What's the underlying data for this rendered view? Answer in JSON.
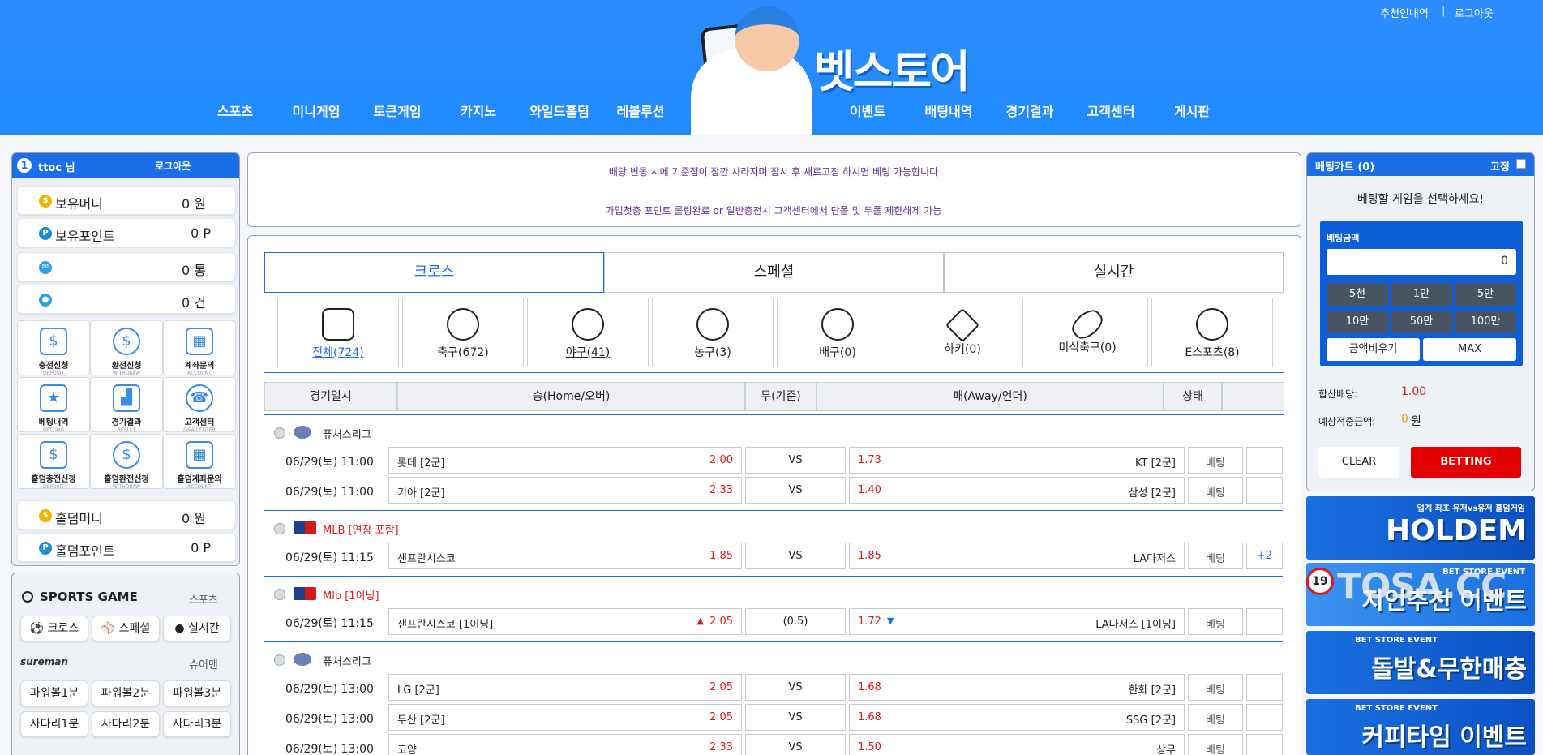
{
  "header": {
    "top_links": [
      "추천인내역",
      "로그아웃"
    ],
    "logo": "벳스토어",
    "nav_left": [
      "스포츠",
      "미니게임",
      "토큰게임",
      "카지노",
      "와일드홀덤",
      "레볼루션"
    ],
    "nav_right": [
      "이벤트",
      "배팅내역",
      "경기결과",
      "고객센터",
      "게시판"
    ],
    "colors": {
      "header_bg": "#1f8bff",
      "accent": "#0d6efd"
    }
  },
  "user": {
    "level": "1",
    "name": "ttoc 님",
    "logout": "로그아웃",
    "rows": [
      {
        "label": "보유머니",
        "value": "0 원",
        "icon": "coin-icon"
      },
      {
        "label": "보유포인트",
        "value": "0 P",
        "icon": "point-icon"
      },
      {
        "label": "",
        "value": "0 통",
        "icon": "bird-icon"
      },
      {
        "label": "",
        "value": "0 건",
        "icon": "message-icon"
      }
    ],
    "grid": [
      {
        "label": "충전신청",
        "en": "DEPOSIT",
        "icon": "deposit-icon"
      },
      {
        "label": "환전신청",
        "en": "WITHDRAW",
        "icon": "withdraw-icon"
      },
      {
        "label": "계좌문의",
        "en": "ACCOUNT",
        "icon": "account-icon"
      },
      {
        "label": "베팅내역",
        "en": "BETTING",
        "icon": "trophy-icon"
      },
      {
        "label": "경기결과",
        "en": "RESULT",
        "icon": "podium-icon"
      },
      {
        "label": "고객센터",
        "en": "Q&A CENTER",
        "icon": "phone-icon"
      },
      {
        "label": "홀덤충전신청",
        "en": "DEPOSIT",
        "icon": "deposit-icon"
      },
      {
        "label": "홀덤환전신청",
        "en": "WITHDRAW",
        "icon": "withdraw-icon"
      },
      {
        "label": "홀덤계좌문의",
        "en": "ACCOUNT",
        "icon": "account-icon"
      }
    ],
    "holdem_rows": [
      {
        "label": "홀덤머니",
        "value": "0 원"
      },
      {
        "label": "홀덤포인트",
        "value": "0 P"
      }
    ]
  },
  "sports_game": {
    "title": "SPORTS GAME",
    "sub": "스포츠",
    "buttons": [
      "크로스",
      "스페셜",
      "실시간"
    ],
    "sureman_logo": "sureman",
    "sureman_sub": "슈어맨",
    "mini": [
      "파워볼1분",
      "파워볼2분",
      "파워볼3분",
      "사다리1분",
      "사다리2분",
      "사다리3분"
    ]
  },
  "notices": [
    "배당 변동 시에 기준점이 잠깐 사라지며 잠시 후 새로고침 하시면 베팅 가능합니다",
    "가입첫충 포인트 롤링완료 or 일반충전시 고객센터에서 단폴 및 두폴 제한해제 가능"
  ],
  "tabs": [
    "크로스",
    "스페셜",
    "실시간"
  ],
  "sports": [
    {
      "label": "전체(724)",
      "icon": "grid-icon"
    },
    {
      "label": "축구(672)",
      "icon": "soccer-icon"
    },
    {
      "label": "야구(41)",
      "icon": "baseball-icon"
    },
    {
      "label": "농구(3)",
      "icon": "basketball-icon"
    },
    {
      "label": "배구(0)",
      "icon": "volleyball-icon"
    },
    {
      "label": "하키(0)",
      "icon": "hockey-icon"
    },
    {
      "label": "미식축구(0)",
      "icon": "football-icon"
    },
    {
      "label": "E스포츠(8)",
      "icon": "esports-icon"
    }
  ],
  "table_headers": [
    "경기일시",
    "승(Home/오버)",
    "무(기준)",
    "패(Away/언더)",
    "상태"
  ],
  "leagues": [
    {
      "name": "퓨처스리그",
      "red": false,
      "flag": "kbo",
      "games": [
        {
          "time": "06/29(토) 11:00",
          "home": "롯데 [2군]",
          "ho": "2.00",
          "mid": "VS",
          "ao": "1.73",
          "away": "KT [2군]",
          "status": "베팅",
          "more": ""
        },
        {
          "time": "06/29(토) 11:00",
          "home": "기아 [2군]",
          "ho": "2.33",
          "mid": "VS",
          "ao": "1.40",
          "away": "삼성 [2군]",
          "status": "베팅",
          "more": ""
        }
      ]
    },
    {
      "name": "MLB [연장 포함]",
      "red": true,
      "flag": "mlb",
      "games": [
        {
          "time": "06/29(토) 11:15",
          "home": "샌프란시스코",
          "ho": "1.85",
          "mid": "VS",
          "ao": "1.85",
          "away": "LA다저스",
          "status": "베팅",
          "more": "+2"
        }
      ]
    },
    {
      "name": "Mlb [1이닝]",
      "red": true,
      "flag": "mlb",
      "games": [
        {
          "time": "06/29(토) 11:15",
          "home": "샌프란시스코 [1이닝]",
          "ho": "2.05",
          "mid": "(0.5)",
          "ao": "1.72",
          "away": "LA다저스 [1이닝]",
          "status": "베팅",
          "more": "",
          "up": true
        }
      ]
    },
    {
      "name": "퓨처스리그",
      "red": false,
      "flag": "kbo",
      "games": [
        {
          "time": "06/29(토) 13:00",
          "home": "LG [2군]",
          "ho": "2.05",
          "mid": "VS",
          "ao": "1.68",
          "away": "한화 [2군]",
          "status": "베팅",
          "more": ""
        },
        {
          "time": "06/29(토) 13:00",
          "home": "두산 [2군]",
          "ho": "2.05",
          "mid": "VS",
          "ao": "1.68",
          "away": "SSG [2군]",
          "status": "베팅",
          "more": ""
        },
        {
          "time": "06/29(토) 13:00",
          "home": "고양",
          "ho": "2.33",
          "mid": "VS",
          "ao": "1.50",
          "away": "상무",
          "status": "베팅",
          "more": ""
        }
      ]
    }
  ],
  "betcart": {
    "title": "베팅카트 (0)",
    "fix": "고정",
    "prompt": "베팅할 게임을 선택하세요!",
    "amount_label": "베팅금액",
    "amount": "0",
    "amounts": [
      "5천",
      "1만",
      "5만",
      "10만",
      "50만",
      "100만"
    ],
    "clear_amount": "금액비우기",
    "max": "MAX",
    "odds_label": "합산배당:",
    "odds": "1.00",
    "win_label": "예상적중금액:",
    "win_value": "0",
    "win_unit": "원",
    "clear": "CLEAR",
    "betting": "BETTING"
  },
  "banners": [
    {
      "sub": "업계 최초 유저vs유저 홀덤게임",
      "title": "HOLDEM"
    },
    {
      "sub": "BET STORE EVENT",
      "title": "지인추천 이벤트",
      "badge": "19"
    },
    {
      "sub": "BET STORE EVENT",
      "title": "돌발&무한매충"
    },
    {
      "sub": "BET STORE EVENT",
      "title": "커피타임 이벤트"
    }
  ],
  "watermark": "TOSA.CC"
}
